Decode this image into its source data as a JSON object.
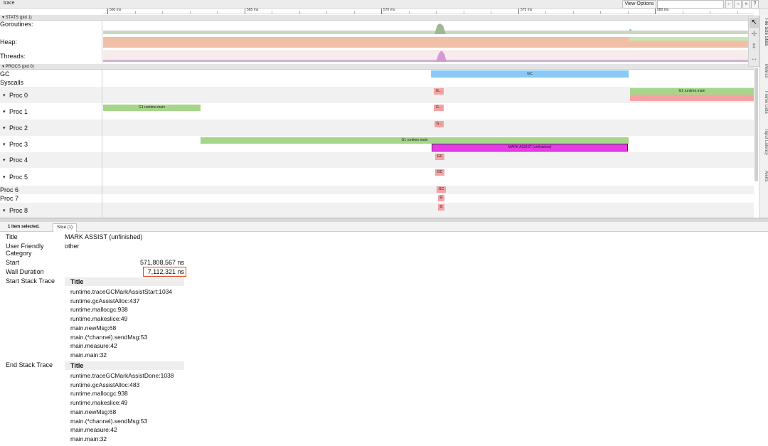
{
  "window": {
    "title": "trace"
  },
  "toolbar": {
    "view_options": "View Options",
    "search_placeholder": "",
    "nav": [
      "←",
      "→",
      "»",
      "?"
    ]
  },
  "ruler": {
    "ticks": [
      "560 ms",
      "565 ms",
      "570 ms",
      "575 ms",
      "580 ms"
    ]
  },
  "stats_section": {
    "header": "▾ STATS (pid 1)",
    "rows": [
      {
        "label": "Goroutines:"
      },
      {
        "label": "Heap:"
      },
      {
        "label": "Threads:"
      }
    ]
  },
  "procs_section": {
    "header": "▾ PROCS (pid 0)",
    "rows": {
      "gc": {
        "label": "GC",
        "slice": "GC"
      },
      "syscalls": {
        "label": "Syscalls"
      },
      "proc0": {
        "label": "Proc 0",
        "slice_a": "G...",
        "slice_b": "G1 runtime.main"
      },
      "proc1": {
        "label": "Proc 1",
        "slice_a": "G1 runtime.main",
        "slice_b": "G..."
      },
      "proc2": {
        "label": "Proc 2",
        "slice_a": "G..."
      },
      "proc3": {
        "label": "Proc 3",
        "slice_a": "G1 runtime.main",
        "slice_b": "MARK ASSIST (unfinished)"
      },
      "proc4": {
        "label": "Proc 4",
        "slice_a": "GC"
      },
      "proc5": {
        "label": "Proc 5",
        "slice_a": "GC"
      },
      "proc6": {
        "label": "Proc 6",
        "slice_a": "GC"
      },
      "proc7": {
        "label": "Proc 7",
        "slice_a": "G"
      },
      "proc8": {
        "label": "Proc 8",
        "slice_a": "G"
      }
    }
  },
  "side_tabs": [
    "File Size Stats",
    "Metrics",
    "Frame Data",
    "Input Latency",
    "Alerts"
  ],
  "bottom_tabs": {
    "selected_count": "1 item selected.",
    "slice_tab": "Slice (1)"
  },
  "details": {
    "title_label": "Title",
    "title_value": "MARK ASSIST (unfinished)",
    "category_label": "User Friendly Category",
    "category_value": "other",
    "start_label": "Start",
    "start_value": "571,808,567 ns",
    "wall_label": "Wall Duration",
    "wall_value": "7,112,321 ns",
    "start_stack_label": "Start Stack Trace",
    "end_stack_label": "End Stack Trace",
    "stack_column_header": "Title",
    "start_stack": [
      "runtime.traceGCMarkAssistStart:1034",
      "runtime.gcAssistAlloc:437",
      "runtime.mallocgc:938",
      "runtime.makeslice:49",
      "main.newMsg:68",
      "main.(*channel).sendMsg:53",
      "main.measure:42",
      "main.main:32"
    ],
    "end_stack": [
      "runtime.traceGCMarkAssistDone:1038",
      "runtime.gcAssistAlloc:483",
      "runtime.mallocgc:938",
      "runtime.makeslice:49",
      "main.newMsg:68",
      "main.(*channel).sendMsg:53",
      "main.measure:42",
      "main.main:32"
    ]
  },
  "colors": {
    "green": "#a6d68a",
    "pink": "#f4a3a3",
    "magenta": "#e93ae8",
    "blue": "#89c9f7",
    "highlight": "#e0421e"
  }
}
